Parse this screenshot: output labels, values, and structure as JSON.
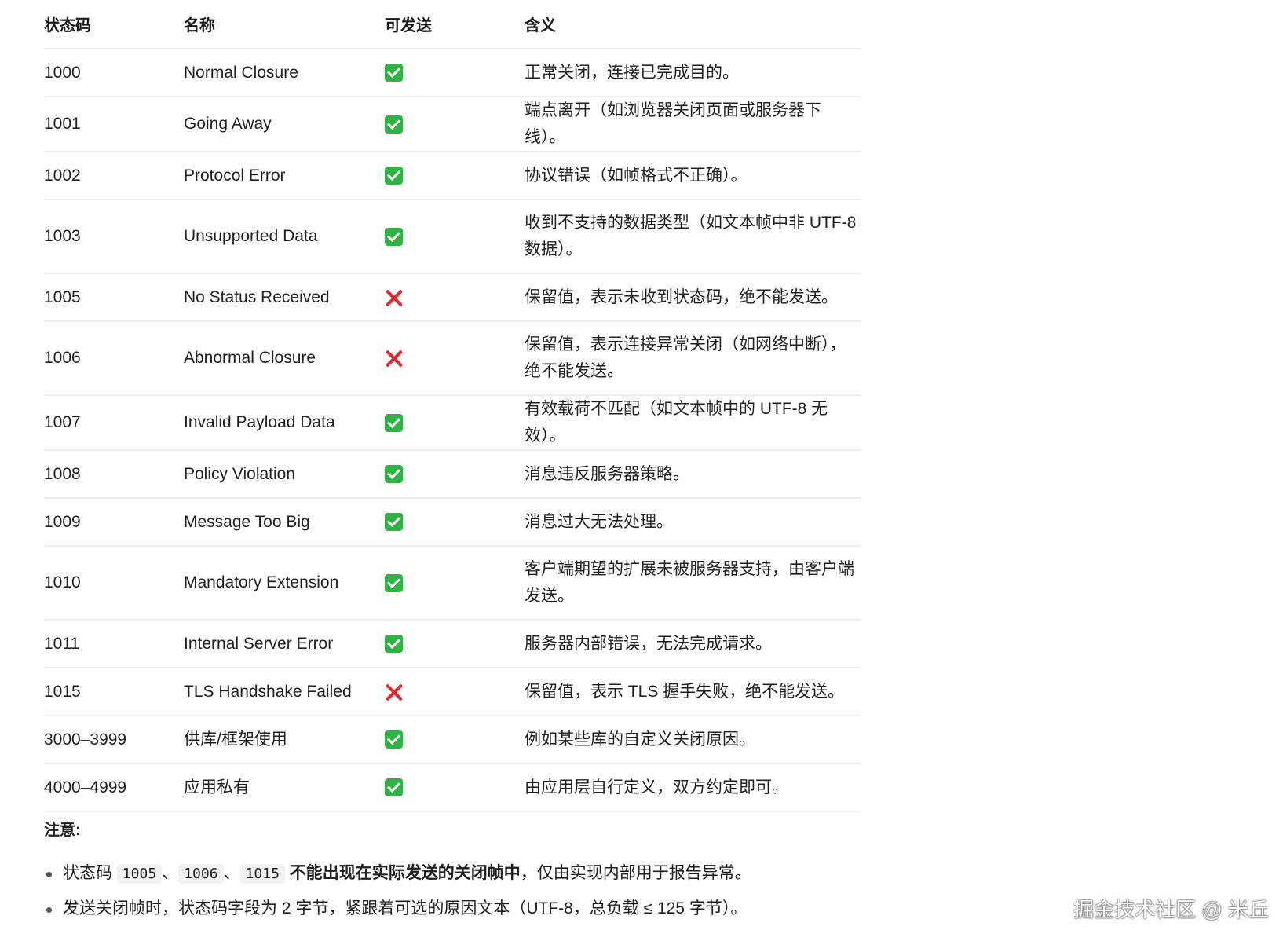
{
  "table": {
    "headers": [
      "状态码",
      "名称",
      "可发送",
      "含义"
    ],
    "rows": [
      {
        "code": "1000",
        "name": "Normal Closure",
        "sendable": true,
        "meaning": "正常关闭，连接已完成目的。"
      },
      {
        "code": "1001",
        "name": "Going Away",
        "sendable": true,
        "meaning": "端点离开（如浏览器关闭页面或服务器下线）。"
      },
      {
        "code": "1002",
        "name": "Protocol Error",
        "sendable": true,
        "meaning": "协议错误（如帧格式不正确）。"
      },
      {
        "code": "1003",
        "name": "Unsupported Data",
        "sendable": true,
        "meaning": "收到不支持的数据类型（如文本帧中非 UTF-8 数据）。"
      },
      {
        "code": "1005",
        "name": "No Status Received",
        "sendable": false,
        "meaning": "保留值，表示未收到状态码，绝不能发送。"
      },
      {
        "code": "1006",
        "name": "Abnormal Closure",
        "sendable": false,
        "meaning": "保留值，表示连接异常关闭（如网络中断），绝不能发送。"
      },
      {
        "code": "1007",
        "name": "Invalid Payload Data",
        "sendable": true,
        "meaning": "有效载荷不匹配（如文本帧中的 UTF-8 无效）。"
      },
      {
        "code": "1008",
        "name": "Policy Violation",
        "sendable": true,
        "meaning": "消息违反服务器策略。"
      },
      {
        "code": "1009",
        "name": "Message Too Big",
        "sendable": true,
        "meaning": "消息过大无法处理。"
      },
      {
        "code": "1010",
        "name": "Mandatory Extension",
        "sendable": true,
        "meaning": "客户端期望的扩展未被服务器支持，由客户端发送。"
      },
      {
        "code": "1011",
        "name": "Internal Server Error",
        "sendable": true,
        "meaning": "服务器内部错误，无法完成请求。"
      },
      {
        "code": "1015",
        "name": "TLS Handshake Failed",
        "sendable": false,
        "meaning": "保留值，表示 TLS 握手失败，绝不能发送。"
      },
      {
        "code": "3000–3999",
        "name": "供库/框架使用",
        "sendable": true,
        "meaning": "例如某些库的自定义关闭原因。"
      },
      {
        "code": "4000–4999",
        "name": "应用私有",
        "sendable": true,
        "meaning": "由应用层自行定义，双方约定即可。"
      }
    ]
  },
  "notes": {
    "title": "注意",
    "title_suffix": ":",
    "item1": {
      "prefix": "状态码",
      "code_a": "1005",
      "sep_a": "、",
      "code_b": "1006",
      "sep_b": "、",
      "code_c": "1015",
      "bold": "不能出现在实际发送的关闭帧中",
      "suffix": "，仅由实现内部用于报告异常。"
    },
    "item2": "发送关闭帧时，状态码字段为 2 字节，紧跟着可选的原因文本（UTF-8，总负载 ≤ 125 字节）。"
  },
  "watermark": "掘金技术社区 @ 米丘",
  "icons": {
    "sendable_true": "check-mark-icon",
    "sendable_false": "cross-mark-icon"
  },
  "colors": {
    "check": "#2fb344",
    "cross": "#e5262b"
  }
}
